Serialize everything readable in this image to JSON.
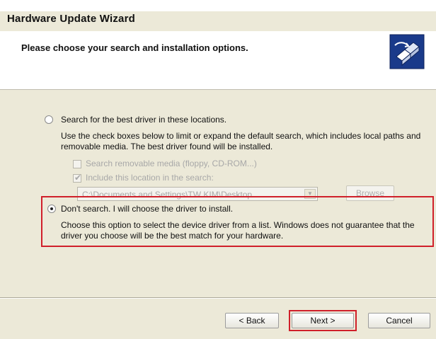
{
  "window": {
    "title": "Hardware Update Wizard"
  },
  "header": {
    "heading": "Please choose your search and installation options.",
    "icon": "hardware-wizard-icon"
  },
  "options": {
    "search": {
      "label": "Search for the best driver in these locations.",
      "selected": false,
      "description": "Use the check boxes below to limit or expand the default search, which includes local paths and removable media. The best driver found will be installed.",
      "removable_media_label": "Search removable media (floppy, CD-ROM...)",
      "removable_media_checked": false,
      "include_location_label": "Include this location in the search:",
      "include_location_checked": true,
      "location_value": "C:\\Documents and Settings\\TW KIM\\Desktop",
      "browse_label": "Browse"
    },
    "dont_search": {
      "label": "Don't search. I will choose the driver to install.",
      "selected": true,
      "description": "Choose this option to select the device driver from a list. Windows does not guarantee that the driver you choose will be the best match for your hardware."
    }
  },
  "footer": {
    "back_label": "< Back",
    "next_label": "Next >",
    "cancel_label": "Cancel"
  },
  "colors": {
    "dialog_background": "#ece9d8",
    "highlight": "#d0202a"
  }
}
